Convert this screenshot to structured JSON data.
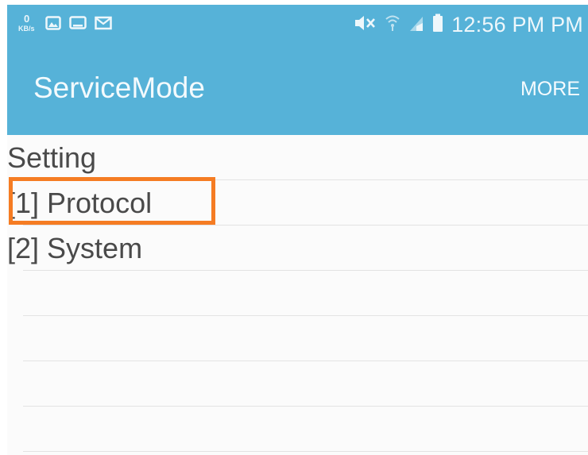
{
  "status_bar": {
    "net_speed_value": "0",
    "net_speed_unit": "KB/s",
    "icons_left": [
      "image-icon",
      "screen-icon",
      "mail-icon"
    ],
    "icons_right": [
      "mute-icon",
      "wifi-icon",
      "signal-icon",
      "battery-icon"
    ],
    "time": "12:56 PM PM"
  },
  "action_bar": {
    "title": "ServiceMode",
    "more_label": "MORE",
    "background_color": "#56b2d8"
  },
  "list": {
    "items": [
      {
        "label": "Setting"
      },
      {
        "label": "[1] Protocol"
      },
      {
        "label": "[2] System"
      }
    ],
    "highlight_color": "#f57c23"
  }
}
